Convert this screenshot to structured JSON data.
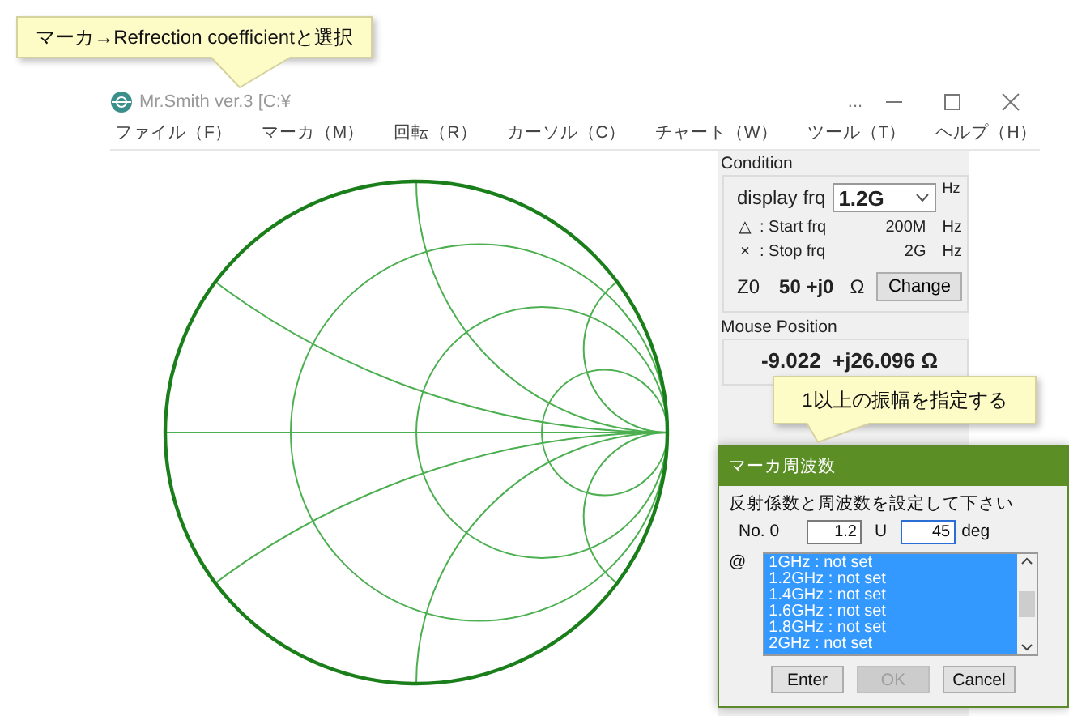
{
  "window": {
    "title": "Mr.Smith ver.3 [C:¥",
    "more": "..."
  },
  "menu": [
    {
      "label": "ファイル（F）"
    },
    {
      "label": "マーカ（M）"
    },
    {
      "label": "回転（R）"
    },
    {
      "label": "カーソル（C）"
    },
    {
      "label": "チャート（W）"
    },
    {
      "label": "ツール（T）"
    },
    {
      "label": "ヘルプ（H）"
    }
  ],
  "condition": {
    "title": "Condition",
    "display_label": "display frq",
    "display_value": "1.2G",
    "display_unit": "Hz",
    "rows": [
      {
        "symbol": "△",
        "label": ": Start frq",
        "value": "200M",
        "unit": "Hz"
      },
      {
        "symbol": "×",
        "label": ": Stop frq",
        "value": "2G",
        "unit": "Hz"
      }
    ],
    "z0_label": "Z0",
    "z0_value": "50 +j0",
    "z0_unit": "Ω",
    "change_button": "Change"
  },
  "mouse_position": {
    "title": "Mouse Position",
    "value": "-9.022  +j26.096 Ω"
  },
  "dialog": {
    "title": "マーカ周波数",
    "instruction": "反射係数と周波数を設定して下さい",
    "no_label": "No. 0",
    "magnitude": "1.2",
    "separator": "U",
    "angle": "45",
    "angle_unit": "deg",
    "list_label": "@",
    "items": [
      {
        "text": "1GHz : not set",
        "selected": true
      },
      {
        "text": "1.2GHz : not set",
        "selected": true
      },
      {
        "text": "1.4GHz : not set",
        "selected": true
      },
      {
        "text": "1.6GHz : not set",
        "selected": true
      },
      {
        "text": "1.8GHz : not set",
        "selected": true
      },
      {
        "text": "2GHz : not set",
        "selected": true
      }
    ],
    "buttons": [
      {
        "label": "Enter",
        "disabled": false
      },
      {
        "label": "OK",
        "disabled": true
      },
      {
        "label": "Cancel",
        "disabled": false
      }
    ]
  },
  "callouts": [
    {
      "text": "マーカ→Refrection coefficientと選択"
    },
    {
      "text": "1以上の振幅を指定する"
    }
  ]
}
